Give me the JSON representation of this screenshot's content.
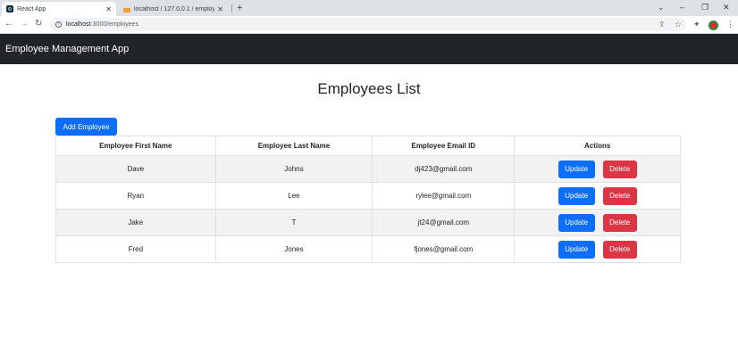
{
  "browser": {
    "tabs": [
      {
        "title": "React App",
        "active": true
      },
      {
        "title": "localhost / 127.0.0.1 / employee",
        "active": false
      }
    ],
    "address": {
      "host": "localhost",
      "path": ":3000/employees"
    },
    "icons": [
      "back-arrow-icon",
      "forward-arrow-icon",
      "reload-icon",
      "info-icon",
      "share-icon",
      "star-icon",
      "extensions-icon",
      "profile-avatar",
      "kebab-menu-icon"
    ]
  },
  "app": {
    "brand": "Employee Management App",
    "title": "Employees List",
    "add_button": "Add Employee",
    "table": {
      "headers": [
        "Employee First Name",
        "Employee Last Name",
        "Employee Email ID",
        "Actions"
      ],
      "rows": [
        {
          "first": "Dave",
          "last": "Johns",
          "email": "dj423@gmail.com"
        },
        {
          "first": "Ryan",
          "last": "Lee",
          "email": "rylee@gmail.com"
        },
        {
          "first": "Jake",
          "last": "T",
          "email": "jt24@gmail.com"
        },
        {
          "first": "Fred",
          "last": "Jones",
          "email": "fjones@gmail.com"
        }
      ],
      "update_label": "Update",
      "delete_label": "Delete"
    },
    "colors": {
      "navbar": "#212529",
      "primary": "#0d6efd",
      "danger": "#dc3545",
      "stripe": "#f2f2f2"
    }
  }
}
